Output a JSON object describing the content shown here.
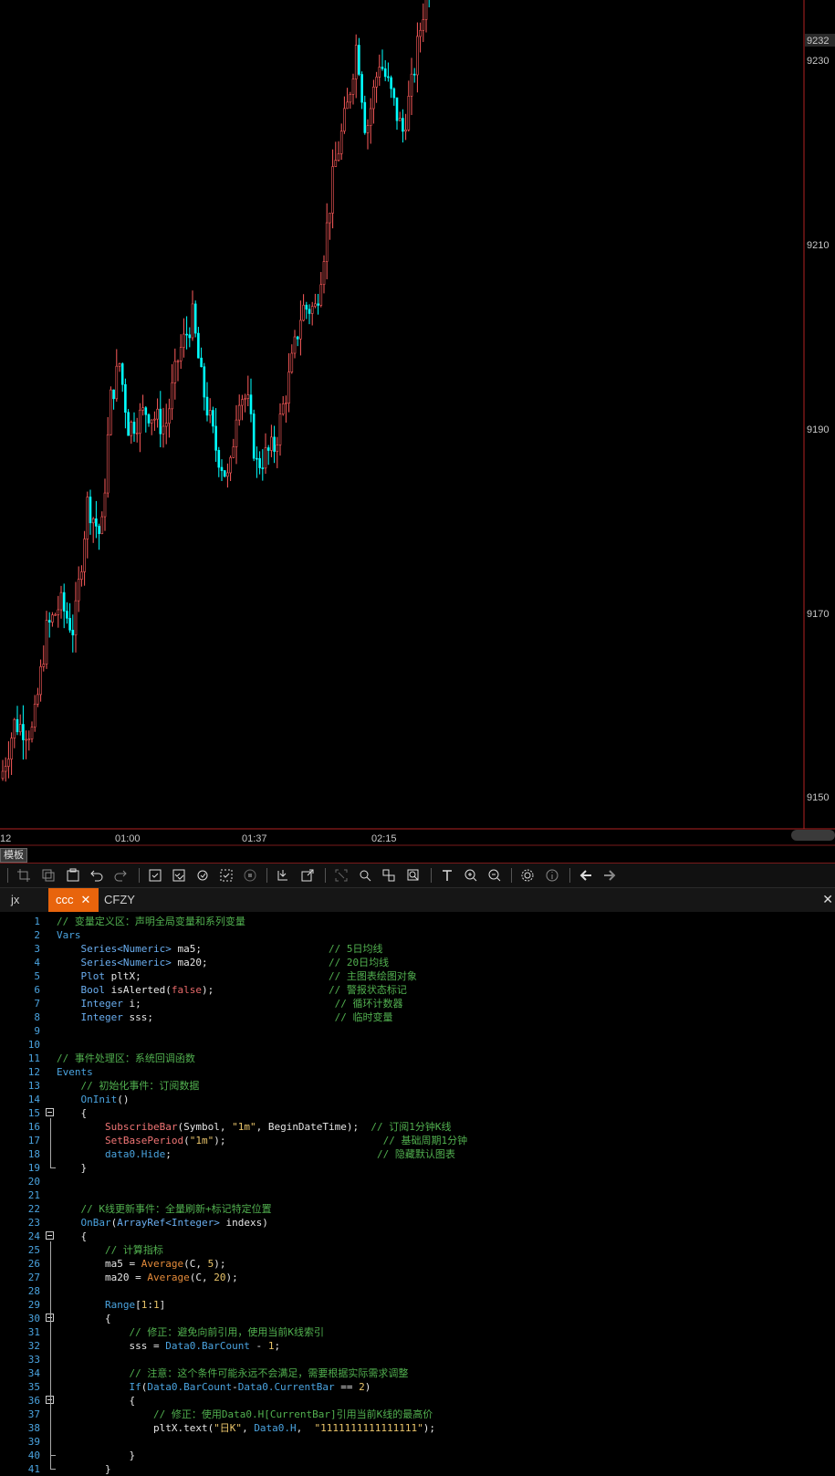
{
  "chart": {
    "current_price": "9232",
    "price_ticks": [
      "9230",
      "9210",
      "9190",
      "9170",
      "9150"
    ],
    "time_ticks": [
      "12",
      "01:00",
      "01:37",
      "02:15"
    ],
    "colors": {
      "up": "#ff5c5c",
      "down": "#00ffff",
      "axis": "#b22222",
      "background": "#000000"
    }
  },
  "template_tab": "模板",
  "toolbar": {
    "icons": [
      "crop-icon",
      "copy-icon",
      "paste-icon",
      "undo-icon",
      "redo-icon",
      "check-icon",
      "check-all-icon",
      "refresh-icon",
      "select-icon",
      "stop-icon",
      "import-icon",
      "export-icon",
      "fit-icon",
      "search-icon",
      "find-replace-icon",
      "find-in-files-icon",
      "text-icon",
      "zoom-in-icon",
      "zoom-out-icon",
      "settings-icon",
      "info-icon",
      "back-arrow-icon",
      "forward-arrow-icon"
    ]
  },
  "tabs": [
    {
      "label": "jx"
    },
    {
      "label": "ccc",
      "close": "✕"
    },
    {
      "label": "CFZY"
    }
  ],
  "tabs_close": "✕",
  "code_lines": [
    {
      "n": "1",
      "t": [
        [
          "c-com",
          "// 变量定义区：声明全局变量和系列变量"
        ]
      ]
    },
    {
      "n": "2",
      "t": [
        [
          "c-kw",
          "Vars"
        ]
      ]
    },
    {
      "n": "3",
      "t": [
        [
          "c-txt",
          "    "
        ],
        [
          "c-type",
          "Series<Numeric>"
        ],
        [
          "c-txt",
          " ma5;                     "
        ],
        [
          "c-com",
          "// 5日均线"
        ]
      ]
    },
    {
      "n": "4",
      "t": [
        [
          "c-txt",
          "    "
        ],
        [
          "c-type",
          "Series<Numeric>"
        ],
        [
          "c-txt",
          " ma20;                    "
        ],
        [
          "c-com",
          "// 20日均线"
        ]
      ]
    },
    {
      "n": "5",
      "t": [
        [
          "c-txt",
          "    "
        ],
        [
          "c-type",
          "Plot"
        ],
        [
          "c-txt",
          " pltX;                               "
        ],
        [
          "c-com",
          "// 主图表绘图对象"
        ]
      ]
    },
    {
      "n": "6",
      "t": [
        [
          "c-txt",
          "    "
        ],
        [
          "c-type",
          "Bool"
        ],
        [
          "c-txt",
          " isAlerted("
        ],
        [
          "c-bool",
          "false"
        ],
        [
          "c-txt",
          ");                   "
        ],
        [
          "c-com",
          "// 警报状态标记"
        ]
      ]
    },
    {
      "n": "7",
      "t": [
        [
          "c-txt",
          "    "
        ],
        [
          "c-type",
          "Integer"
        ],
        [
          "c-txt",
          " i;                                "
        ],
        [
          "c-com",
          "// 循环计数器"
        ]
      ]
    },
    {
      "n": "8",
      "t": [
        [
          "c-txt",
          "    "
        ],
        [
          "c-type",
          "Integer"
        ],
        [
          "c-txt",
          " sss;                              "
        ],
        [
          "c-com",
          "// 临时变量"
        ]
      ]
    },
    {
      "n": "9",
      "t": []
    },
    {
      "n": "10",
      "t": []
    },
    {
      "n": "11",
      "t": [
        [
          "c-com",
          "// 事件处理区：系统回调函数"
        ]
      ]
    },
    {
      "n": "12",
      "t": [
        [
          "c-kw",
          "Events"
        ]
      ]
    },
    {
      "n": "13",
      "t": [
        [
          "c-txt",
          "    "
        ],
        [
          "c-com",
          "// 初始化事件：订阅数据"
        ]
      ]
    },
    {
      "n": "14",
      "t": [
        [
          "c-txt",
          "    "
        ],
        [
          "c-fn",
          "OnInit"
        ],
        [
          "c-txt",
          "()"
        ]
      ]
    },
    {
      "n": "15",
      "t": [
        [
          "c-txt",
          "    {"
        ]
      ],
      "fold": true
    },
    {
      "n": "16",
      "t": [
        [
          "c-txt",
          "        "
        ],
        [
          "c-red",
          "SubscribeBar"
        ],
        [
          "c-txt",
          "(Symbol, "
        ],
        [
          "c-str",
          "\"1m\""
        ],
        [
          "c-txt",
          ", BeginDateTime);  "
        ],
        [
          "c-com",
          "// 订阅1分钟K线"
        ]
      ]
    },
    {
      "n": "17",
      "t": [
        [
          "c-txt",
          "        "
        ],
        [
          "c-red",
          "SetBasePeriod"
        ],
        [
          "c-txt",
          "("
        ],
        [
          "c-str",
          "\"1m\""
        ],
        [
          "c-txt",
          ");                          "
        ],
        [
          "c-com",
          "// 基础周期1分钟"
        ]
      ]
    },
    {
      "n": "18",
      "t": [
        [
          "c-txt",
          "        "
        ],
        [
          "c-fn",
          "data0.Hide"
        ],
        [
          "c-txt",
          ";                                  "
        ],
        [
          "c-com",
          "// 隐藏默认图表"
        ]
      ]
    },
    {
      "n": "19",
      "t": [
        [
          "c-txt",
          "    }"
        ]
      ]
    },
    {
      "n": "20",
      "t": []
    },
    {
      "n": "21",
      "t": []
    },
    {
      "n": "22",
      "t": [
        [
          "c-txt",
          "    "
        ],
        [
          "c-com",
          "// K线更新事件：全量刷新+标记特定位置"
        ]
      ]
    },
    {
      "n": "23",
      "t": [
        [
          "c-txt",
          "    "
        ],
        [
          "c-fn",
          "OnBar"
        ],
        [
          "c-txt",
          "("
        ],
        [
          "c-type",
          "ArrayRef<Integer>"
        ],
        [
          "c-txt",
          " indexs)"
        ]
      ]
    },
    {
      "n": "24",
      "t": [
        [
          "c-txt",
          "    {"
        ]
      ],
      "fold": true
    },
    {
      "n": "25",
      "t": [
        [
          "c-txt",
          "        "
        ],
        [
          "c-com",
          "// 计算指标"
        ]
      ]
    },
    {
      "n": "26",
      "t": [
        [
          "c-txt",
          "        ma5 = "
        ],
        [
          "c-or",
          "Average"
        ],
        [
          "c-txt",
          "(C, "
        ],
        [
          "c-num",
          "5"
        ],
        [
          "c-txt",
          ");"
        ]
      ]
    },
    {
      "n": "27",
      "t": [
        [
          "c-txt",
          "        ma20 = "
        ],
        [
          "c-or",
          "Average"
        ],
        [
          "c-txt",
          "(C, "
        ],
        [
          "c-num",
          "20"
        ],
        [
          "c-txt",
          ");"
        ]
      ]
    },
    {
      "n": "28",
      "t": []
    },
    {
      "n": "29",
      "t": [
        [
          "c-txt",
          "        "
        ],
        [
          "c-fn",
          "Range"
        ],
        [
          "c-txt",
          "["
        ],
        [
          "c-num",
          "1"
        ],
        [
          "c-txt",
          ":"
        ],
        [
          "c-num",
          "1"
        ],
        [
          "c-txt",
          "]"
        ]
      ]
    },
    {
      "n": "30",
      "t": [
        [
          "c-txt",
          "        {"
        ]
      ],
      "fold": true
    },
    {
      "n": "31",
      "t": [
        [
          "c-txt",
          "            "
        ],
        [
          "c-com",
          "// 修正：避免向前引用，使用当前K线索引"
        ]
      ]
    },
    {
      "n": "32",
      "t": [
        [
          "c-txt",
          "            sss = "
        ],
        [
          "c-fn",
          "Data0.BarCount"
        ],
        [
          "c-txt",
          " - "
        ],
        [
          "c-num",
          "1"
        ],
        [
          "c-txt",
          ";"
        ]
      ]
    },
    {
      "n": "33",
      "t": []
    },
    {
      "n": "34",
      "t": [
        [
          "c-txt",
          "            "
        ],
        [
          "c-com",
          "// 注意：这个条件可能永远不会满足，需要根据实际需求调整"
        ]
      ]
    },
    {
      "n": "35",
      "t": [
        [
          "c-txt",
          "            "
        ],
        [
          "c-fn",
          "If"
        ],
        [
          "c-txt",
          "("
        ],
        [
          "c-fn",
          "Data0.BarCount"
        ],
        [
          "c-txt",
          "-"
        ],
        [
          "c-fn",
          "Data0.CurrentBar"
        ],
        [
          "c-txt",
          " == "
        ],
        [
          "c-num",
          "2"
        ],
        [
          "c-txt",
          ")"
        ]
      ]
    },
    {
      "n": "36",
      "t": [
        [
          "c-txt",
          "            {"
        ]
      ],
      "fold": true
    },
    {
      "n": "37",
      "t": [
        [
          "c-txt",
          "                "
        ],
        [
          "c-com",
          "// 修正：使用Data0.H[CurrentBar]引用当前K线的最高价"
        ]
      ]
    },
    {
      "n": "38",
      "t": [
        [
          "c-txt",
          "                pltX.text("
        ],
        [
          "c-str",
          "\"日K\""
        ],
        [
          "c-txt",
          ", "
        ],
        [
          "c-fn",
          "Data0.H"
        ],
        [
          "c-txt",
          ",  "
        ],
        [
          "c-str",
          "\"1111111111111111\""
        ],
        [
          "c-txt",
          ");"
        ]
      ]
    },
    {
      "n": "39",
      "t": []
    },
    {
      "n": "40",
      "t": [
        [
          "c-txt",
          "            }"
        ]
      ]
    },
    {
      "n": "41",
      "t": [
        [
          "c-txt",
          "        }"
        ]
      ]
    }
  ]
}
